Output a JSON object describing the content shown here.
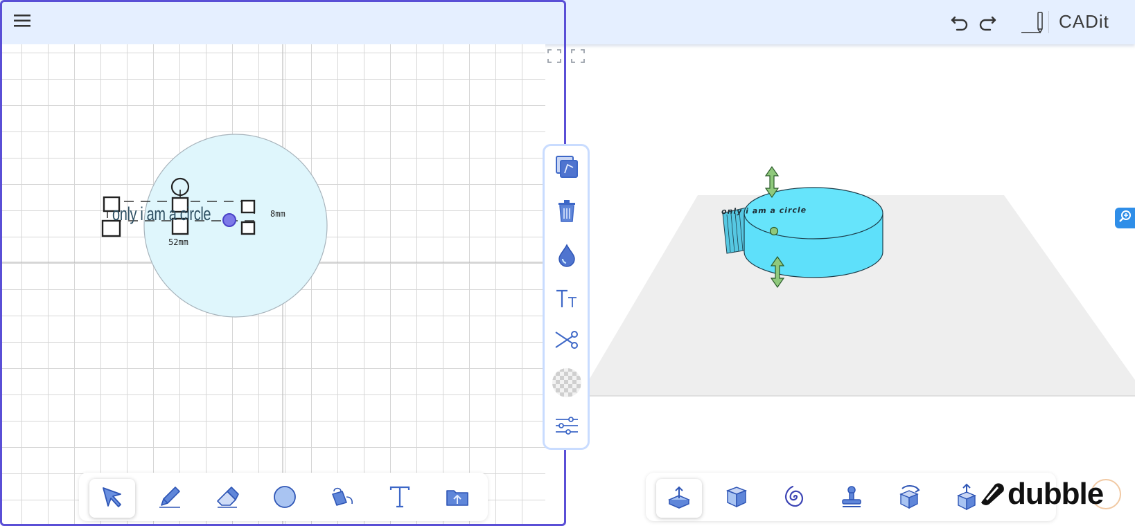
{
  "app": {
    "title": "CADit",
    "watermark": "dubble"
  },
  "toolbar_top": {
    "menu_icon": "hamburger-menu-icon",
    "undo_icon": "undo-icon",
    "redo_icon": "redo-icon",
    "pencil_icon": "pencil-icon"
  },
  "sketch": {
    "shape_text": "only i am a circle",
    "width_label": "52mm",
    "height_label": "8mm"
  },
  "viewport": {
    "label_text": "only i am a circle"
  },
  "side_tools": [
    {
      "name": "copy-tool",
      "icon": "copy-icon"
    },
    {
      "name": "delete-tool",
      "icon": "trash-icon"
    },
    {
      "name": "color-tool",
      "icon": "droplet-icon"
    },
    {
      "name": "text-size-tool",
      "icon": "text-size-icon"
    },
    {
      "name": "cut-tool",
      "icon": "scissors-icon"
    },
    {
      "name": "transparency-tool",
      "icon": "checker-icon"
    },
    {
      "name": "settings-tool",
      "icon": "sliders-icon"
    }
  ],
  "sketch_tools": [
    {
      "name": "select",
      "icon": "cursor-arrow-icon",
      "active": true
    },
    {
      "name": "draw",
      "icon": "pencil-icon",
      "active": false
    },
    {
      "name": "erase",
      "icon": "eraser-icon",
      "active": false
    },
    {
      "name": "circle",
      "icon": "circle-icon",
      "active": false
    },
    {
      "name": "fill",
      "icon": "paint-bucket-icon",
      "active": false
    },
    {
      "name": "text",
      "icon": "text-icon",
      "active": false
    },
    {
      "name": "open-folder",
      "icon": "folder-icon",
      "active": false
    }
  ],
  "model_tools": [
    {
      "name": "extrude",
      "icon": "extrude-icon",
      "active": true
    },
    {
      "name": "box",
      "icon": "cube-icon",
      "active": false
    },
    {
      "name": "spiral",
      "icon": "spiral-icon",
      "active": false
    },
    {
      "name": "stamp",
      "icon": "stamp-icon",
      "active": false
    },
    {
      "name": "rotate",
      "icon": "rotate-cube-icon",
      "active": false
    },
    {
      "name": "export",
      "icon": "export-cube-icon",
      "active": false
    }
  ],
  "colors": {
    "accent": "#5a4fd6",
    "topbar": "#e5efff",
    "shape_fill": "#dff6fc",
    "solid_fill": "#5ee0fa",
    "icon_blue": "#3d67c7",
    "arrow_green": "#8fc97c"
  }
}
